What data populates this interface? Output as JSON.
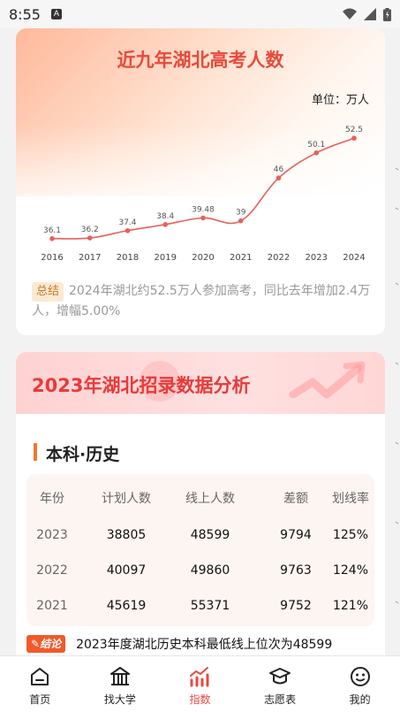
{
  "status_bar": {
    "time": "8:55",
    "a_icon": "A"
  },
  "card1": {
    "title": "近九年湖北高考人数",
    "unit": "单位：万人",
    "summary_tag": "总结",
    "summary_text": "2024年湖北约52.5万人参加高考，同比去年增加2.4万人，增幅5.00%"
  },
  "chart_data": {
    "type": "line",
    "title": "近九年湖北高考人数",
    "x": [
      "2016",
      "2017",
      "2018",
      "2019",
      "2020",
      "2021",
      "2022",
      "2023",
      "2024"
    ],
    "series": [
      {
        "values": [
          36.1,
          36.2,
          37.4,
          38.4,
          39.48,
          39,
          46,
          50.1,
          52.5
        ]
      }
    ],
    "value_labels": [
      "36.1",
      "36.2",
      "37.4",
      "38.4",
      "39.48",
      "39",
      "46",
      "50.1",
      "52.5"
    ],
    "ylim": [
      30,
      56
    ],
    "grid": false,
    "line_color": "#e8605a"
  },
  "card2": {
    "title": "2023年湖北招录数据分析",
    "section_title": "本科·历史",
    "table": {
      "headers": [
        "年份",
        "计划人数",
        "线上人数",
        "差额",
        "划线率"
      ],
      "rows": [
        [
          "2023",
          "38805",
          "48599",
          "9794",
          "125%"
        ],
        [
          "2022",
          "40097",
          "49860",
          "9763",
          "124%"
        ],
        [
          "2021",
          "45619",
          "55371",
          "9752",
          "121%"
        ]
      ]
    },
    "conclusion_tag": "结论",
    "conclusion_text": "2023年度湖北历史本科最低线上位次为48599"
  },
  "nav": {
    "items": [
      {
        "label": "首页",
        "icon": "home-icon"
      },
      {
        "label": "找大学",
        "icon": "university-icon"
      },
      {
        "label": "指数",
        "icon": "chart-icon"
      },
      {
        "label": "志愿表",
        "icon": "graduation-cap-icon"
      },
      {
        "label": "我的",
        "icon": "smiley-icon"
      }
    ],
    "active_index": 2,
    "active_color": "#e84a3c"
  }
}
